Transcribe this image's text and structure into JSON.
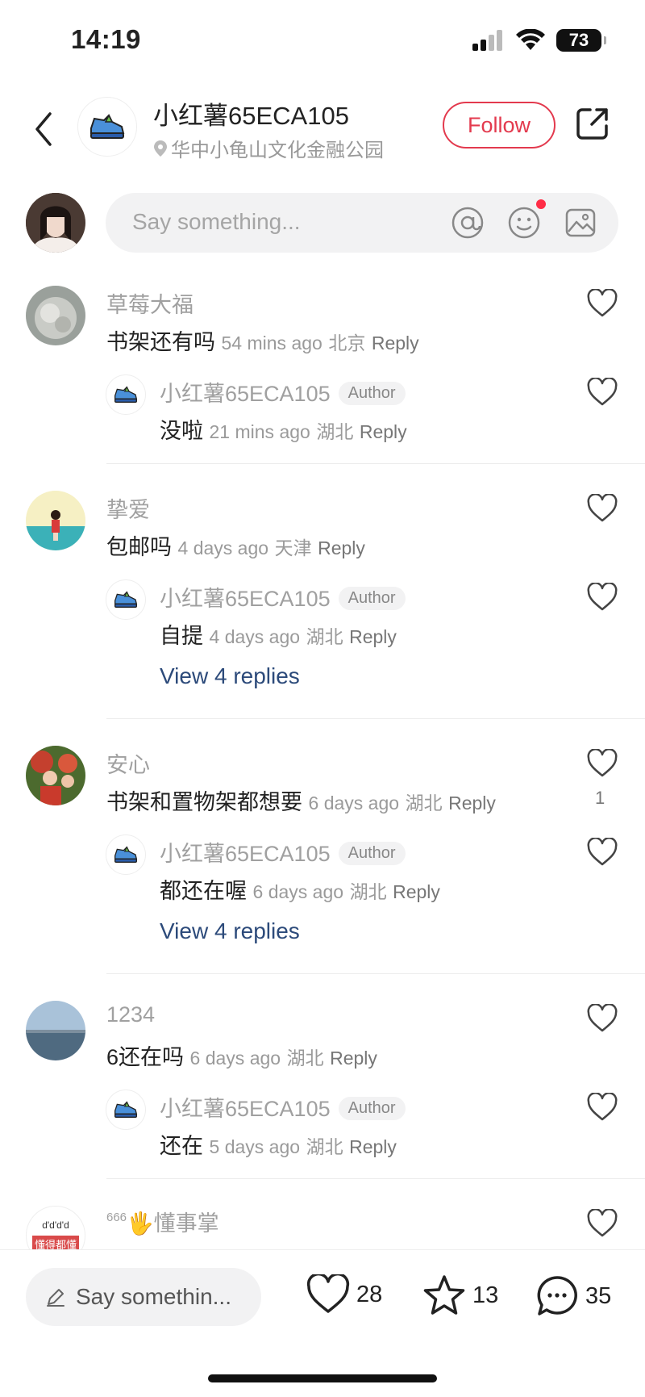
{
  "status_bar": {
    "time": "14:19",
    "battery": "73"
  },
  "header": {
    "title": "小红薯65ECA105",
    "location": "华中小龟山文化金融公园",
    "follow_label": "Follow"
  },
  "comment_input": {
    "placeholder": "Say something..."
  },
  "comments": [
    {
      "name": "草莓大福",
      "text": "书架还有吗",
      "time": "54 mins ago",
      "place": "北京",
      "reply_label": "Reply",
      "reply": {
        "name": "小红薯65ECA105",
        "badge": "Author",
        "text": "没啦",
        "time": "21 mins ago",
        "place": "湖北",
        "reply_label": "Reply"
      }
    },
    {
      "name": "挚爱",
      "text": "包邮吗",
      "time": "4 days ago",
      "place": "天津",
      "reply_label": "Reply",
      "reply": {
        "name": "小红薯65ECA105",
        "badge": "Author",
        "text": "自提",
        "time": "4 days ago",
        "place": "湖北",
        "reply_label": "Reply"
      },
      "view_replies": "View 4 replies"
    },
    {
      "name": "安心",
      "text": "书架和置物架都想要",
      "time": "6 days ago",
      "place": "湖北",
      "reply_label": "Reply",
      "like_count": "1",
      "reply": {
        "name": "小红薯65ECA105",
        "badge": "Author",
        "text": "都还在喔",
        "time": "6 days ago",
        "place": "湖北",
        "reply_label": "Reply"
      },
      "view_replies": "View 4 replies"
    },
    {
      "name": "1234",
      "text": "6还在吗",
      "time": "6 days ago",
      "place": "湖北",
      "reply_label": "Reply",
      "reply": {
        "name": "小红薯65ECA105",
        "badge": "Author",
        "text": "还在",
        "time": "5 days ago",
        "place": "湖北",
        "reply_label": "Reply"
      }
    },
    {
      "name_prefix": "666",
      "emoji": "🖐",
      "name": "懂事掌",
      "avatar_text_top": "d'd'd'd",
      "avatar_text_bottom": "懂得都懂"
    }
  ],
  "bottom_bar": {
    "placeholder": "Say somethin...",
    "likes": "28",
    "collects": "13",
    "comments": "35"
  },
  "colors": {
    "accent": "#e33a4e",
    "link": "#2c4a7a",
    "muted": "#9a9a9a"
  }
}
